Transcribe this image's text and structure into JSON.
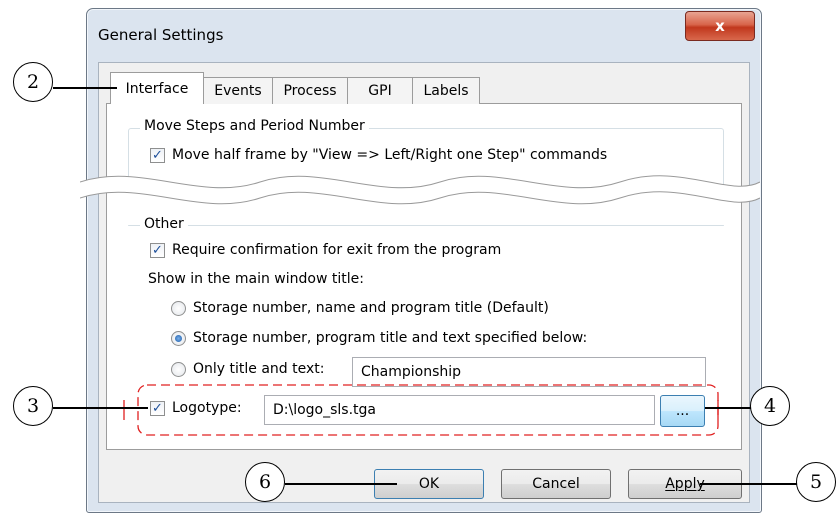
{
  "window": {
    "title": "General Settings",
    "close_glyph": "x"
  },
  "tabs": [
    {
      "label": "Interface",
      "selected": true
    },
    {
      "label": "Events",
      "selected": false
    },
    {
      "label": "Process",
      "selected": false
    },
    {
      "label": "GPI",
      "selected": false
    },
    {
      "label": "Labels",
      "selected": false
    }
  ],
  "move_steps": {
    "group_label": "Move Steps and Period Number",
    "move_half_frame": {
      "label": "Move half frame by \"View => Left/Right one Step\" commands",
      "checked": true
    }
  },
  "other": {
    "group_label": "Other",
    "require_confirmation": {
      "label": "Require confirmation for exit from the program",
      "checked": true
    },
    "show_title_label": "Show in the main window title:",
    "radio_options": [
      {
        "label": "Storage number, name and program title (Default)",
        "selected": false
      },
      {
        "label": "Storage number, program title and text specified below:",
        "selected": true
      },
      {
        "label": "Only title and text:",
        "selected": false
      }
    ],
    "title_text_value": "Championship",
    "logotype": {
      "label": "Logotype:",
      "checked": true,
      "path_value": "D:\\logo_sls.tga",
      "browse_label": "..."
    }
  },
  "buttons": {
    "ok": "OK",
    "cancel": "Cancel",
    "apply": "Apply"
  },
  "callouts": {
    "c2": "2",
    "c3": "3",
    "c4": "4",
    "c5": "5",
    "c6": "6"
  },
  "colors": {
    "dashed_highlight": "#e02020",
    "focus_blue": "#3c7fb1"
  }
}
